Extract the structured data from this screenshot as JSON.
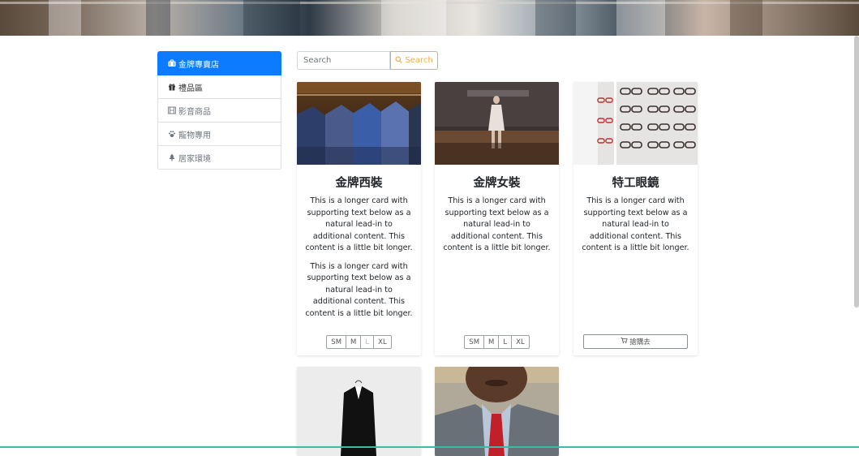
{
  "sidebar": {
    "items": [
      {
        "label": "金牌專賣店",
        "icon": "briefcase-icon",
        "active": true
      },
      {
        "label": "禮品區",
        "icon": "gift-icon"
      },
      {
        "label": "影音商品",
        "icon": "film-icon"
      },
      {
        "label": "寵物專用",
        "icon": "paw-icon"
      },
      {
        "label": "居家環境",
        "icon": "tree-icon"
      }
    ]
  },
  "search": {
    "placeholder": "Search",
    "button_label": "Search"
  },
  "products": [
    {
      "title": "金牌西裝",
      "text": "This is a longer card with supporting text below as a natural lead-in to additional content. This content is a little bit longer.",
      "text2": "This is a longer card with supporting text below as a natural lead-in to additional content. This content is a little bit longer.",
      "sizes": [
        "SM",
        "M",
        "L",
        "XL"
      ]
    },
    {
      "title": "金牌女裝",
      "text": "This is a longer card with supporting text below as a natural lead-in to additional content. This content is a little bit longer.",
      "sizes": [
        "SM",
        "M",
        "L",
        "XL"
      ]
    },
    {
      "title": "特工眼鏡",
      "text": "This is a longer card with supporting text below as a natural lead-in to additional content. This content is a little bit longer.",
      "cart_label": "搶購去"
    }
  ],
  "colors": {
    "primary": "#0d7bff",
    "warning": "#f0ad4e"
  }
}
